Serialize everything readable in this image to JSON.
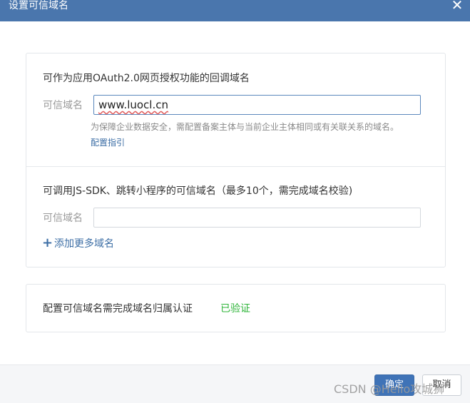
{
  "dialog": {
    "title": "设置可信域名",
    "close_glyph": "✕"
  },
  "oauth_section": {
    "title": "可作为应用OAuth2.0网页授权功能的回调域名",
    "field_label": "可信域名",
    "field_value": "www.luocl.cn",
    "hint_text": "为保障企业数据安全，需配置备案主体与当前企业主体相同或有关联关系的域名。",
    "guide_link": "配置指引"
  },
  "jssdk_section": {
    "title": "可调用JS-SDK、跳转小程序的可信域名（最多10个，需完成域名校验)",
    "field_label": "可信域名",
    "field_value": "",
    "add_more_label": "添加更多域名"
  },
  "verification": {
    "text": "配置可信域名需完成域名归属认证",
    "status": "已验证",
    "status_color": "#2fb53a"
  },
  "footer": {
    "confirm_label": "确定",
    "cancel_label": "取消"
  },
  "watermark": "CSDN @Hello攻城狮"
}
